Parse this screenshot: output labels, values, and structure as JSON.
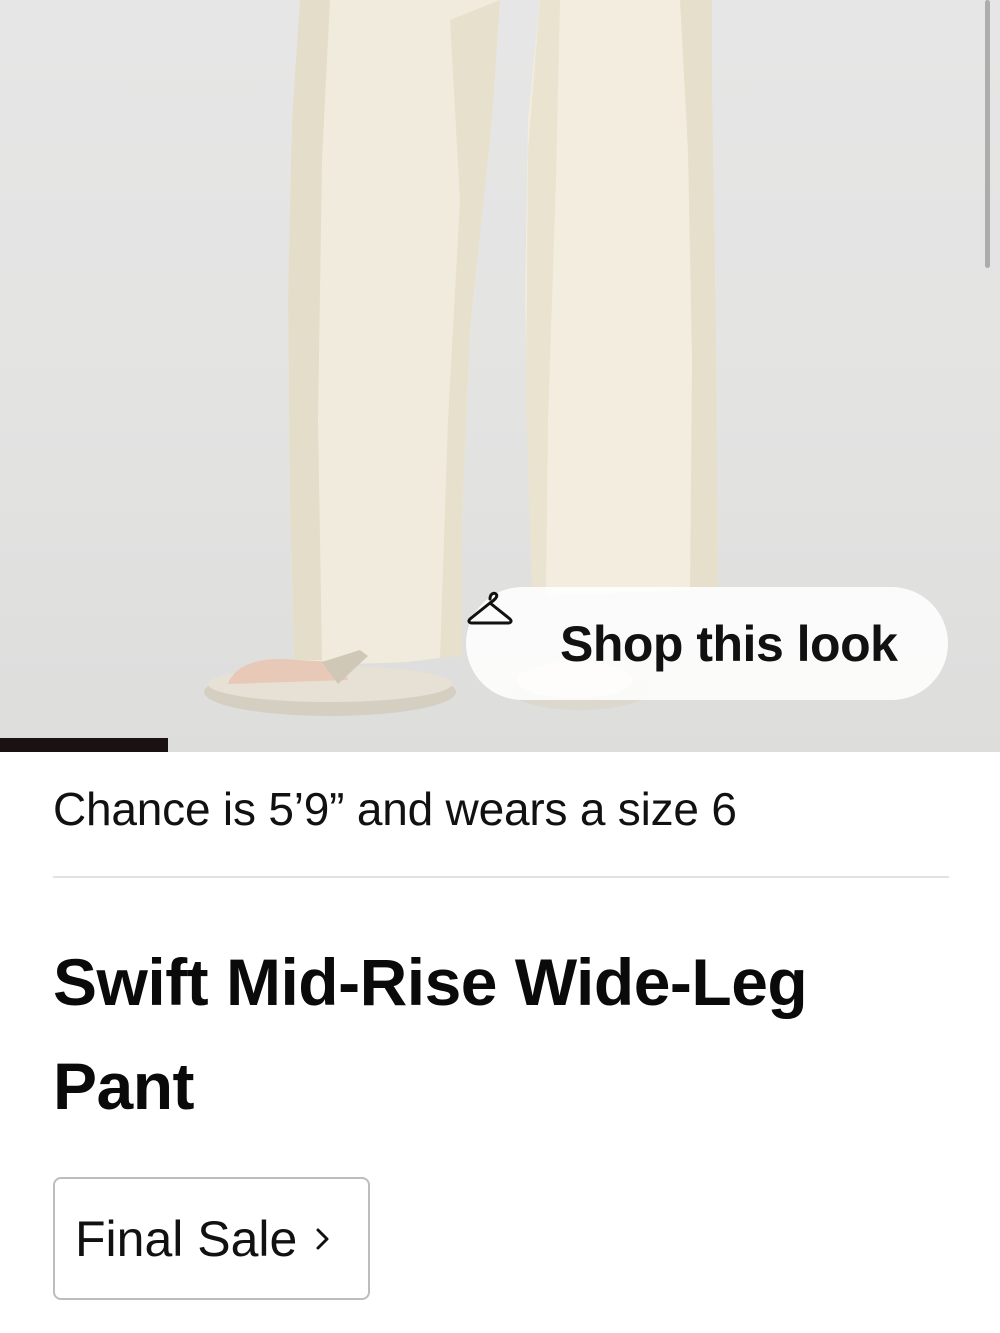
{
  "hero": {
    "image_alt": "Model wearing cream wide-leg pants with sandals",
    "shop_look_label": "Shop this look",
    "gallery_progress": 0.168,
    "colors": {
      "background": "#e4e4e3",
      "pant": "#f1ecdd",
      "pant_shadow": "#e1dac6",
      "sandal": "#d6d1c4"
    }
  },
  "model_info": "Chance is 5’9” and wears a size 6",
  "product": {
    "title": "Swift Mid-Rise Wide-Leg Pant",
    "final_sale_label": "Final Sale"
  },
  "icons": {
    "shop_look": "hanger-icon",
    "final_sale": "chevron-right-icon"
  }
}
